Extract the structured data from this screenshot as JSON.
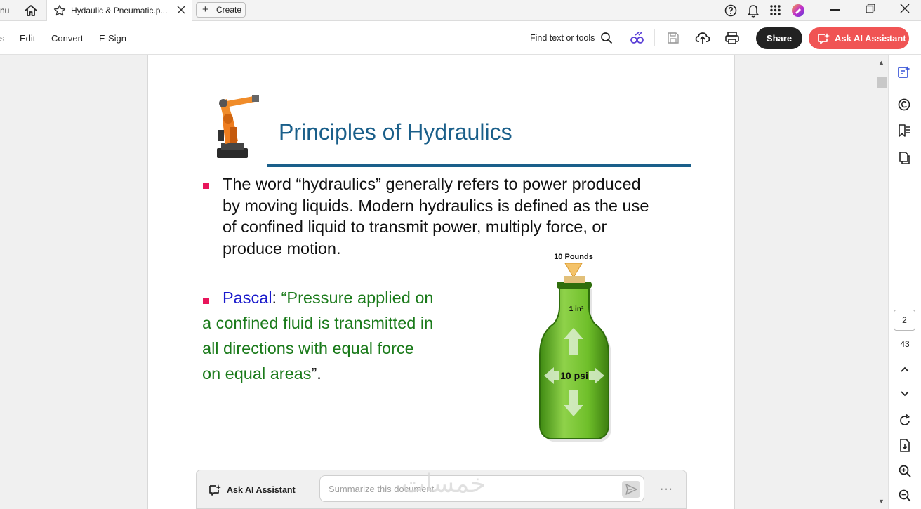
{
  "titlebar": {
    "menu_fragment": "nu",
    "tab_title": "Hydaulic & Pneumatic.p...",
    "create_label": "Create"
  },
  "toolbar": {
    "menu_fragment": "s",
    "menu_items": [
      "Edit",
      "Convert",
      "E-Sign"
    ],
    "find_label": "Find text or tools",
    "share_label": "Share",
    "ai_label": "Ask AI Assistant"
  },
  "slide": {
    "title": "Principles of Hydraulics",
    "bullet1_lines": [
      "The word “hydraulics” generally refers to power produced",
      "by moving liquids. Modern hydraulics is defined as the use",
      "of confined liquid to transmit power, multiply force, or",
      "produce motion."
    ],
    "pascal_name": "Pascal",
    "pascal_colon": ": ",
    "pascal_quote_lines": [
      "“Pressure applied on",
      "a confined fluid is transmitted in",
      "all directions with equal force",
      "on equal areas"
    ],
    "pascal_end": "”.",
    "figure": {
      "top_label": "10 Pounds",
      "area_label": "1 in²",
      "pressure_label": "10 psi"
    }
  },
  "right_rail": {
    "current_page": "2",
    "total_pages": "43"
  },
  "ai_bar": {
    "label": "Ask AI Assistant",
    "placeholder": "Summarize this document",
    "watermark": "خمسات"
  },
  "colors": {
    "title_blue": "#1a5f8a",
    "bullet_pink": "#e8155b",
    "pascal_blue": "#1a1acc",
    "quote_green": "#1a7a1a",
    "ai_button": "#f05454"
  }
}
